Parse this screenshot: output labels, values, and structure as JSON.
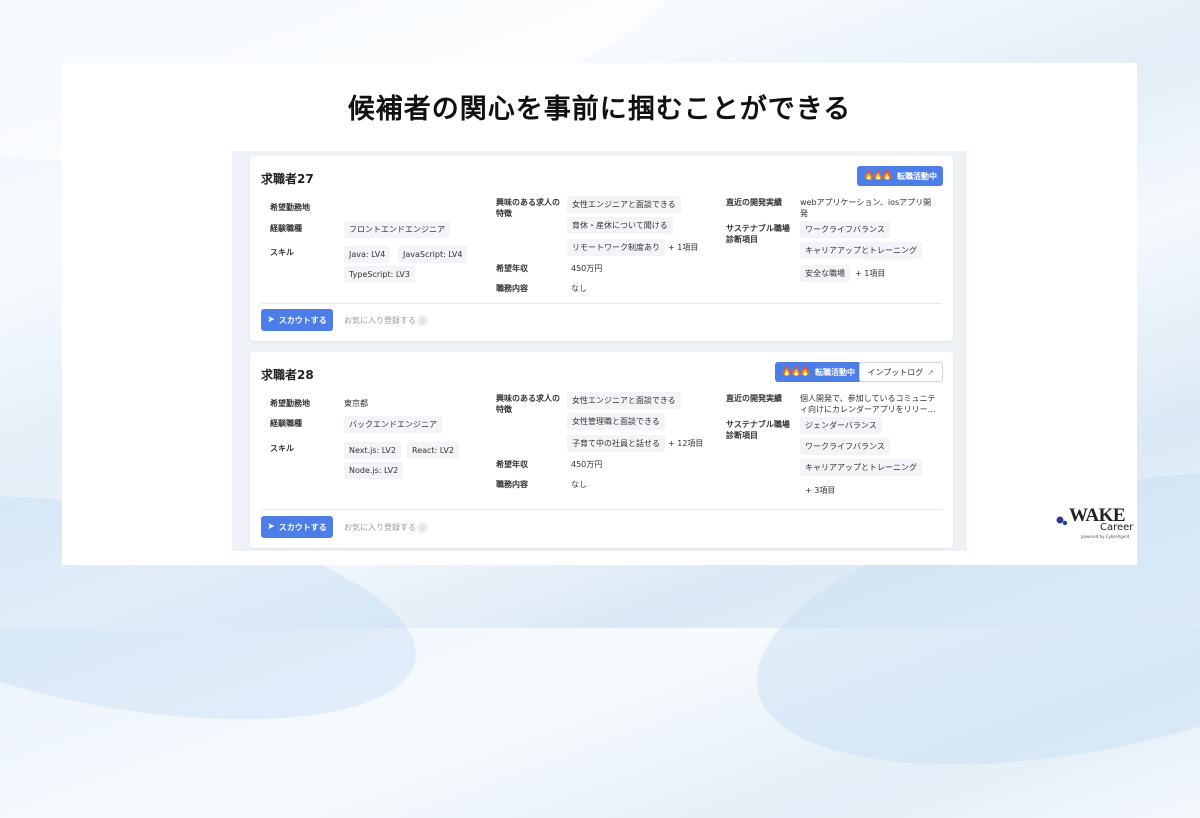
{
  "headline": "候補者の関心を事前に掴むことができる",
  "common": {
    "label_location": "希望勤務地",
    "label_job_type": "経験職種",
    "label_skills": "スキル",
    "label_interest": "興味のある求人の特徴",
    "label_salary": "希望年収",
    "label_duty": "職務内容",
    "label_recent_dev": "直近の開発実績",
    "label_sustainable": "サステナブル職場診断項目",
    "scout_label": "スカウトする",
    "favorite_label": "お気に入り登録する",
    "status_label": "転職活動中",
    "input_log_label": "インプットログ"
  },
  "candidates": [
    {
      "name": "求職者27",
      "location": "",
      "job_type": "フロントエンドエンジニア",
      "skills": [
        "Java: LV4",
        "JavaScript: LV4",
        "TypeScript: LV3"
      ],
      "interests": [
        "女性エンジニアと面談できる",
        "育休・産休について聞ける",
        "リモートワーク制度あり"
      ],
      "interests_more": "+ 1項目",
      "salary": "450万円",
      "duty": "なし",
      "recent_dev": "webアプリケーション、iosアプリ開発",
      "sustainable": [
        "ワークライフバランス",
        "キャリアアップとトレーニング",
        "安全な職場"
      ],
      "sustainable_more": "+ 1項目"
    },
    {
      "name": "求職者28",
      "location": "東京都",
      "job_type": "バックエンドエンジニア",
      "skills": [
        "Next.js: LV2",
        "React: LV2",
        "Node.js: LV2"
      ],
      "interests": [
        "女性エンジニアと面談できる",
        "女性管理職と面談できる",
        "子育て中の社員と話せる"
      ],
      "interests_more": "+ 12項目",
      "salary": "450万円",
      "duty": "なし",
      "recent_dev": "個人開発で、参加しているコミュニティ向けにカレンダーアプリをリリー…",
      "sustainable": [
        "ジェンダーバランス",
        "ワークライフバランス",
        "キャリアアップとトレーニング"
      ],
      "sustainable_more": "+ 3項目"
    }
  ],
  "logo": {
    "wake": "WAKE",
    "career": "Career",
    "powered": "powered by CyberAgent"
  },
  "colors": {
    "accent": "#4d7ee8",
    "fire": "#ff7a1a"
  }
}
